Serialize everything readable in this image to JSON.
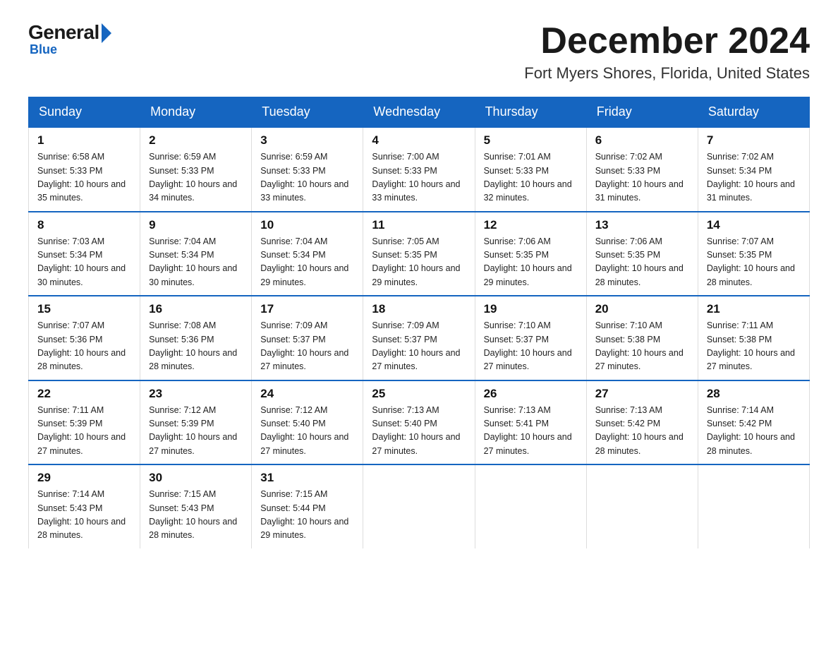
{
  "logo": {
    "general": "General",
    "blue": "Blue",
    "subtitle": "Blue"
  },
  "header": {
    "month": "December 2024",
    "location": "Fort Myers Shores, Florida, United States"
  },
  "days_of_week": [
    "Sunday",
    "Monday",
    "Tuesday",
    "Wednesday",
    "Thursday",
    "Friday",
    "Saturday"
  ],
  "weeks": [
    [
      {
        "day": "1",
        "sunrise": "6:58 AM",
        "sunset": "5:33 PM",
        "daylight": "10 hours and 35 minutes."
      },
      {
        "day": "2",
        "sunrise": "6:59 AM",
        "sunset": "5:33 PM",
        "daylight": "10 hours and 34 minutes."
      },
      {
        "day": "3",
        "sunrise": "6:59 AM",
        "sunset": "5:33 PM",
        "daylight": "10 hours and 33 minutes."
      },
      {
        "day": "4",
        "sunrise": "7:00 AM",
        "sunset": "5:33 PM",
        "daylight": "10 hours and 33 minutes."
      },
      {
        "day": "5",
        "sunrise": "7:01 AM",
        "sunset": "5:33 PM",
        "daylight": "10 hours and 32 minutes."
      },
      {
        "day": "6",
        "sunrise": "7:02 AM",
        "sunset": "5:33 PM",
        "daylight": "10 hours and 31 minutes."
      },
      {
        "day": "7",
        "sunrise": "7:02 AM",
        "sunset": "5:34 PM",
        "daylight": "10 hours and 31 minutes."
      }
    ],
    [
      {
        "day": "8",
        "sunrise": "7:03 AM",
        "sunset": "5:34 PM",
        "daylight": "10 hours and 30 minutes."
      },
      {
        "day": "9",
        "sunrise": "7:04 AM",
        "sunset": "5:34 PM",
        "daylight": "10 hours and 30 minutes."
      },
      {
        "day": "10",
        "sunrise": "7:04 AM",
        "sunset": "5:34 PM",
        "daylight": "10 hours and 29 minutes."
      },
      {
        "day": "11",
        "sunrise": "7:05 AM",
        "sunset": "5:35 PM",
        "daylight": "10 hours and 29 minutes."
      },
      {
        "day": "12",
        "sunrise": "7:06 AM",
        "sunset": "5:35 PM",
        "daylight": "10 hours and 29 minutes."
      },
      {
        "day": "13",
        "sunrise": "7:06 AM",
        "sunset": "5:35 PM",
        "daylight": "10 hours and 28 minutes."
      },
      {
        "day": "14",
        "sunrise": "7:07 AM",
        "sunset": "5:35 PM",
        "daylight": "10 hours and 28 minutes."
      }
    ],
    [
      {
        "day": "15",
        "sunrise": "7:07 AM",
        "sunset": "5:36 PM",
        "daylight": "10 hours and 28 minutes."
      },
      {
        "day": "16",
        "sunrise": "7:08 AM",
        "sunset": "5:36 PM",
        "daylight": "10 hours and 28 minutes."
      },
      {
        "day": "17",
        "sunrise": "7:09 AM",
        "sunset": "5:37 PM",
        "daylight": "10 hours and 27 minutes."
      },
      {
        "day": "18",
        "sunrise": "7:09 AM",
        "sunset": "5:37 PM",
        "daylight": "10 hours and 27 minutes."
      },
      {
        "day": "19",
        "sunrise": "7:10 AM",
        "sunset": "5:37 PM",
        "daylight": "10 hours and 27 minutes."
      },
      {
        "day": "20",
        "sunrise": "7:10 AM",
        "sunset": "5:38 PM",
        "daylight": "10 hours and 27 minutes."
      },
      {
        "day": "21",
        "sunrise": "7:11 AM",
        "sunset": "5:38 PM",
        "daylight": "10 hours and 27 minutes."
      }
    ],
    [
      {
        "day": "22",
        "sunrise": "7:11 AM",
        "sunset": "5:39 PM",
        "daylight": "10 hours and 27 minutes."
      },
      {
        "day": "23",
        "sunrise": "7:12 AM",
        "sunset": "5:39 PM",
        "daylight": "10 hours and 27 minutes."
      },
      {
        "day": "24",
        "sunrise": "7:12 AM",
        "sunset": "5:40 PM",
        "daylight": "10 hours and 27 minutes."
      },
      {
        "day": "25",
        "sunrise": "7:13 AM",
        "sunset": "5:40 PM",
        "daylight": "10 hours and 27 minutes."
      },
      {
        "day": "26",
        "sunrise": "7:13 AM",
        "sunset": "5:41 PM",
        "daylight": "10 hours and 27 minutes."
      },
      {
        "day": "27",
        "sunrise": "7:13 AM",
        "sunset": "5:42 PM",
        "daylight": "10 hours and 28 minutes."
      },
      {
        "day": "28",
        "sunrise": "7:14 AM",
        "sunset": "5:42 PM",
        "daylight": "10 hours and 28 minutes."
      }
    ],
    [
      {
        "day": "29",
        "sunrise": "7:14 AM",
        "sunset": "5:43 PM",
        "daylight": "10 hours and 28 minutes."
      },
      {
        "day": "30",
        "sunrise": "7:15 AM",
        "sunset": "5:43 PM",
        "daylight": "10 hours and 28 minutes."
      },
      {
        "day": "31",
        "sunrise": "7:15 AM",
        "sunset": "5:44 PM",
        "daylight": "10 hours and 29 minutes."
      },
      null,
      null,
      null,
      null
    ]
  ]
}
